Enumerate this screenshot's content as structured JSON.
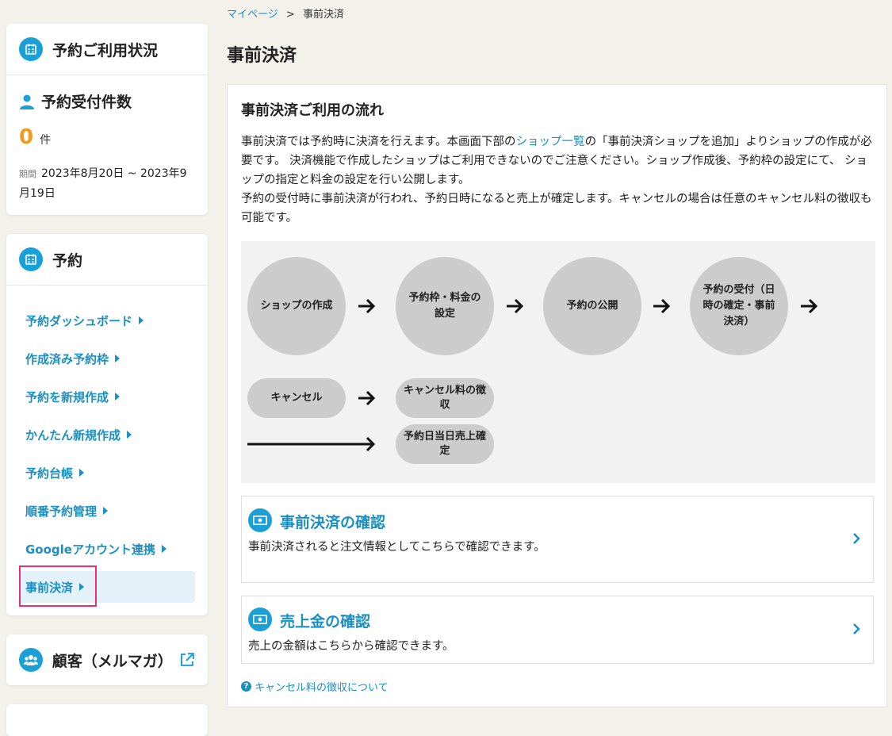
{
  "breadcrumb": {
    "home": "マイページ",
    "sep": ">",
    "current": "事前決済"
  },
  "page_title": "事前決済",
  "sidebar": {
    "status_card": {
      "title": "予約ご利用状況",
      "sub_title": "予約受付件数",
      "count": "0",
      "count_unit": "件",
      "period_label": "期間",
      "period_value": "2023年8月20日 ~ 2023年9月19日"
    },
    "reservation_card": {
      "title": "予約",
      "items": [
        {
          "label": "予約ダッシュボード"
        },
        {
          "label": "作成済み予約枠"
        },
        {
          "label": "予約を新規作成"
        },
        {
          "label": "かんたん新規作成"
        },
        {
          "label": "予約台帳"
        },
        {
          "label": "順番予約管理"
        },
        {
          "label": "Googleアカウント連携"
        },
        {
          "label": "事前決済"
        }
      ]
    },
    "customer_card": {
      "title": "顧客（メルマガ）"
    }
  },
  "main": {
    "section_title": "事前決済ご利用の流れ",
    "desc": {
      "p1_before": "事前決済では予約時に決済を行えます。本画面下部の",
      "p1_link": "ショップ一覧",
      "p1_after": "の「事前決済ショップを追加」よりショップの作成が必要です。 決済機能で作成したショップはご利用できないのでご注意ください。ショップ作成後、予約枠の設定にて、 ショップの指定と料金の設定を行い公開します。",
      "p2": "予約の受付時に事前決済が行われ、予約日時になると売上が確定します。キャンセルの場合は任意のキャンセル料の徴収も可能です。"
    },
    "flow": {
      "step1": "ショップの作成",
      "step2": "予約枠・料金の設定",
      "step3": "予約の公開",
      "step4": "予約の受付（日時の確定・事前決済）",
      "cancel": "キャンセル",
      "cancel_fee": "キャンセル料の徴収",
      "sales_confirm": "予約日当日売上確定"
    },
    "boxes": [
      {
        "title": "事前決済の確認",
        "text": "事前決済されると注文情報としてこちらで確認できます。"
      },
      {
        "title": "売上金の確認",
        "text": "売上の金額はこちらから確認できます。"
      }
    ],
    "help_link": "キャンセル料の徴収について"
  }
}
